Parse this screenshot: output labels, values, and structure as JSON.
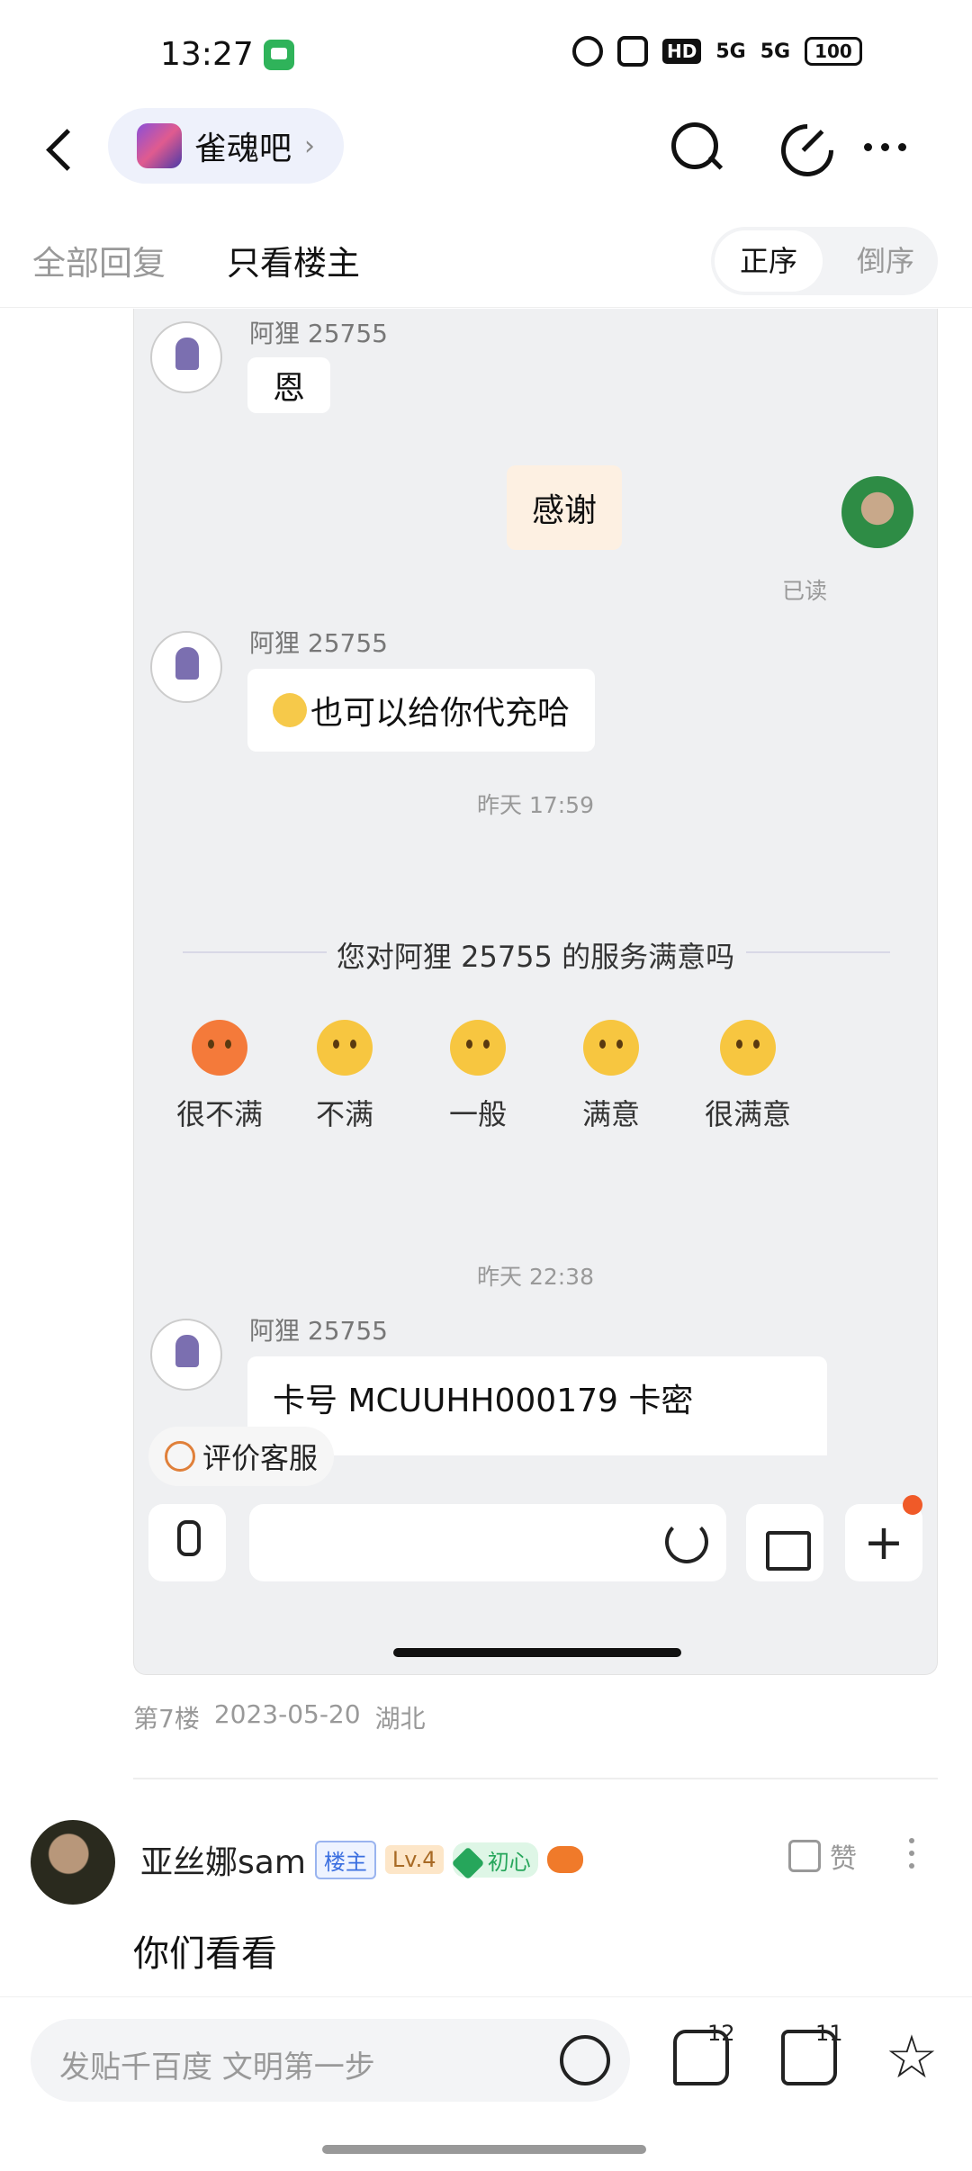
{
  "status_bar": {
    "time": "13:27",
    "network1": "5G",
    "network2": "5G",
    "battery": "100",
    "hd": "HD"
  },
  "header": {
    "forum_name": "雀魂吧",
    "forum_chevron": "›"
  },
  "filter": {
    "all_replies": "全部回复",
    "host_only": "只看楼主",
    "order_asc": "正序",
    "order_desc": "倒序"
  },
  "chat": {
    "agent_name": "阿狸 25755",
    "msg1": "恩",
    "my_msg": "感谢",
    "read_status": "已读",
    "msg2": "也可以给你代充哈",
    "time1": "昨天 17:59",
    "survey_title": "您对阿狸 25755 的服务满意吗",
    "ratings": [
      "很不满",
      "不满",
      "一般",
      "满意",
      "很满意"
    ],
    "time2": "昨天 22:38",
    "msg3": "卡号 MCUUHH000179 卡密",
    "evaluate": "评价客服",
    "plus": "+"
  },
  "post_meta": {
    "floor": "第7楼",
    "date": "2023-05-20",
    "location": "湖北"
  },
  "reply": {
    "user": "亚丝娜sam",
    "tag_host": "楼主",
    "tag_level": "Lv.4",
    "tag_heart_level": "1",
    "tag_heart": "初心",
    "like_label": "赞",
    "text": "你们看看"
  },
  "bottom_bar": {
    "placeholder": "发贴千百度 文明第一步",
    "comment_count": "12",
    "like_count": "11"
  },
  "colors": {
    "accent_blue": "#3b6fe0",
    "notify_dot": "#f05a28",
    "msg_icon_green": "#2fb35a"
  }
}
